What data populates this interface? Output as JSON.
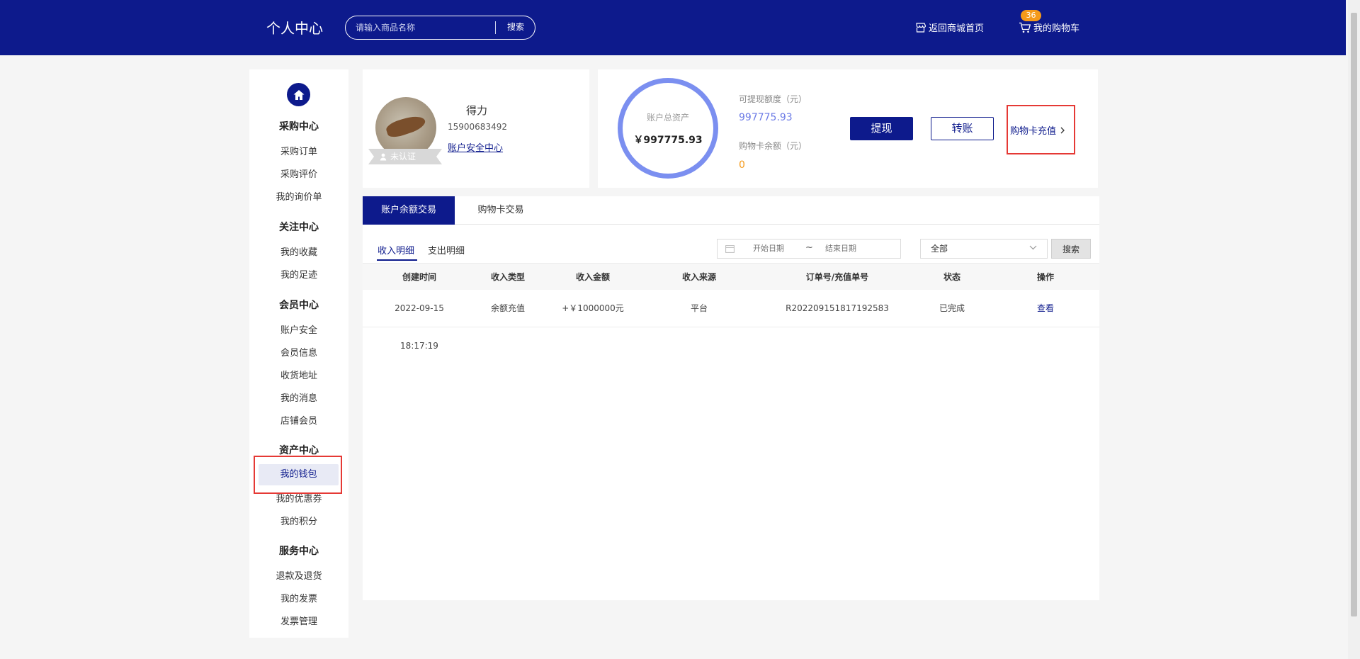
{
  "header": {
    "title": "个人中心",
    "search_placeholder": "请输入商品名称",
    "search_button": "搜索",
    "home_link": "返回商城首页",
    "cart_link": "我的购物车",
    "cart_count": "36"
  },
  "sidebar": {
    "groups": [
      {
        "heading": "采购中心",
        "items": [
          "采购订单",
          "采购评价",
          "我的询价单"
        ]
      },
      {
        "heading": "关注中心",
        "items": [
          "我的收藏",
          "我的足迹"
        ]
      },
      {
        "heading": "会员中心",
        "items": [
          "账户安全",
          "会员信息",
          "收货地址",
          "我的消息",
          "店铺会员"
        ]
      },
      {
        "heading": "资产中心",
        "items": [
          "我的钱包",
          "我的优惠券",
          "我的积分"
        ]
      },
      {
        "heading": "服务中心",
        "items": [
          "退款及退货",
          "我的发票",
          "发票管理"
        ]
      }
    ],
    "active_item": "我的钱包"
  },
  "profile": {
    "name": "得力",
    "phone": "15900683492",
    "security_link": "账户安全中心",
    "badge": "未认证"
  },
  "assets": {
    "total_label": "账户总资产",
    "total_value": "￥997775.93",
    "withdrawable_label": "可提现额度（元）",
    "withdrawable_value": "997775.93",
    "card_balance_label": "购物卡余额（元）",
    "card_balance_value": "0",
    "withdraw_button": "提现",
    "transfer_button": "转账",
    "recharge_link": "购物卡充值",
    "colors": {
      "withdrawable": "#6c7be6",
      "card_balance": "#f59a1a"
    }
  },
  "main": {
    "tabs": [
      "账户余额交易",
      "购物卡交易"
    ],
    "subtabs": [
      "收入明细",
      "支出明细"
    ],
    "date_start_placeholder": "开始日期",
    "date_end_placeholder": "结束日期",
    "date_separator": "~",
    "status_select": "全部",
    "search_button": "搜索",
    "columns": [
      "创建时间",
      "收入类型",
      "收入金额",
      "收入来源",
      "订单号/充值单号",
      "状态",
      "操作"
    ],
    "rows": [
      {
        "created": "2022-09-15 18:17:19",
        "type": "余额充值",
        "amount": "+￥1000000元",
        "source": "平台",
        "order_no": "R202209151817192583",
        "status": "已完成",
        "action": "查看"
      }
    ]
  },
  "theme": {
    "primary": "#0d1a8c",
    "highlight_border": "#e53935"
  }
}
